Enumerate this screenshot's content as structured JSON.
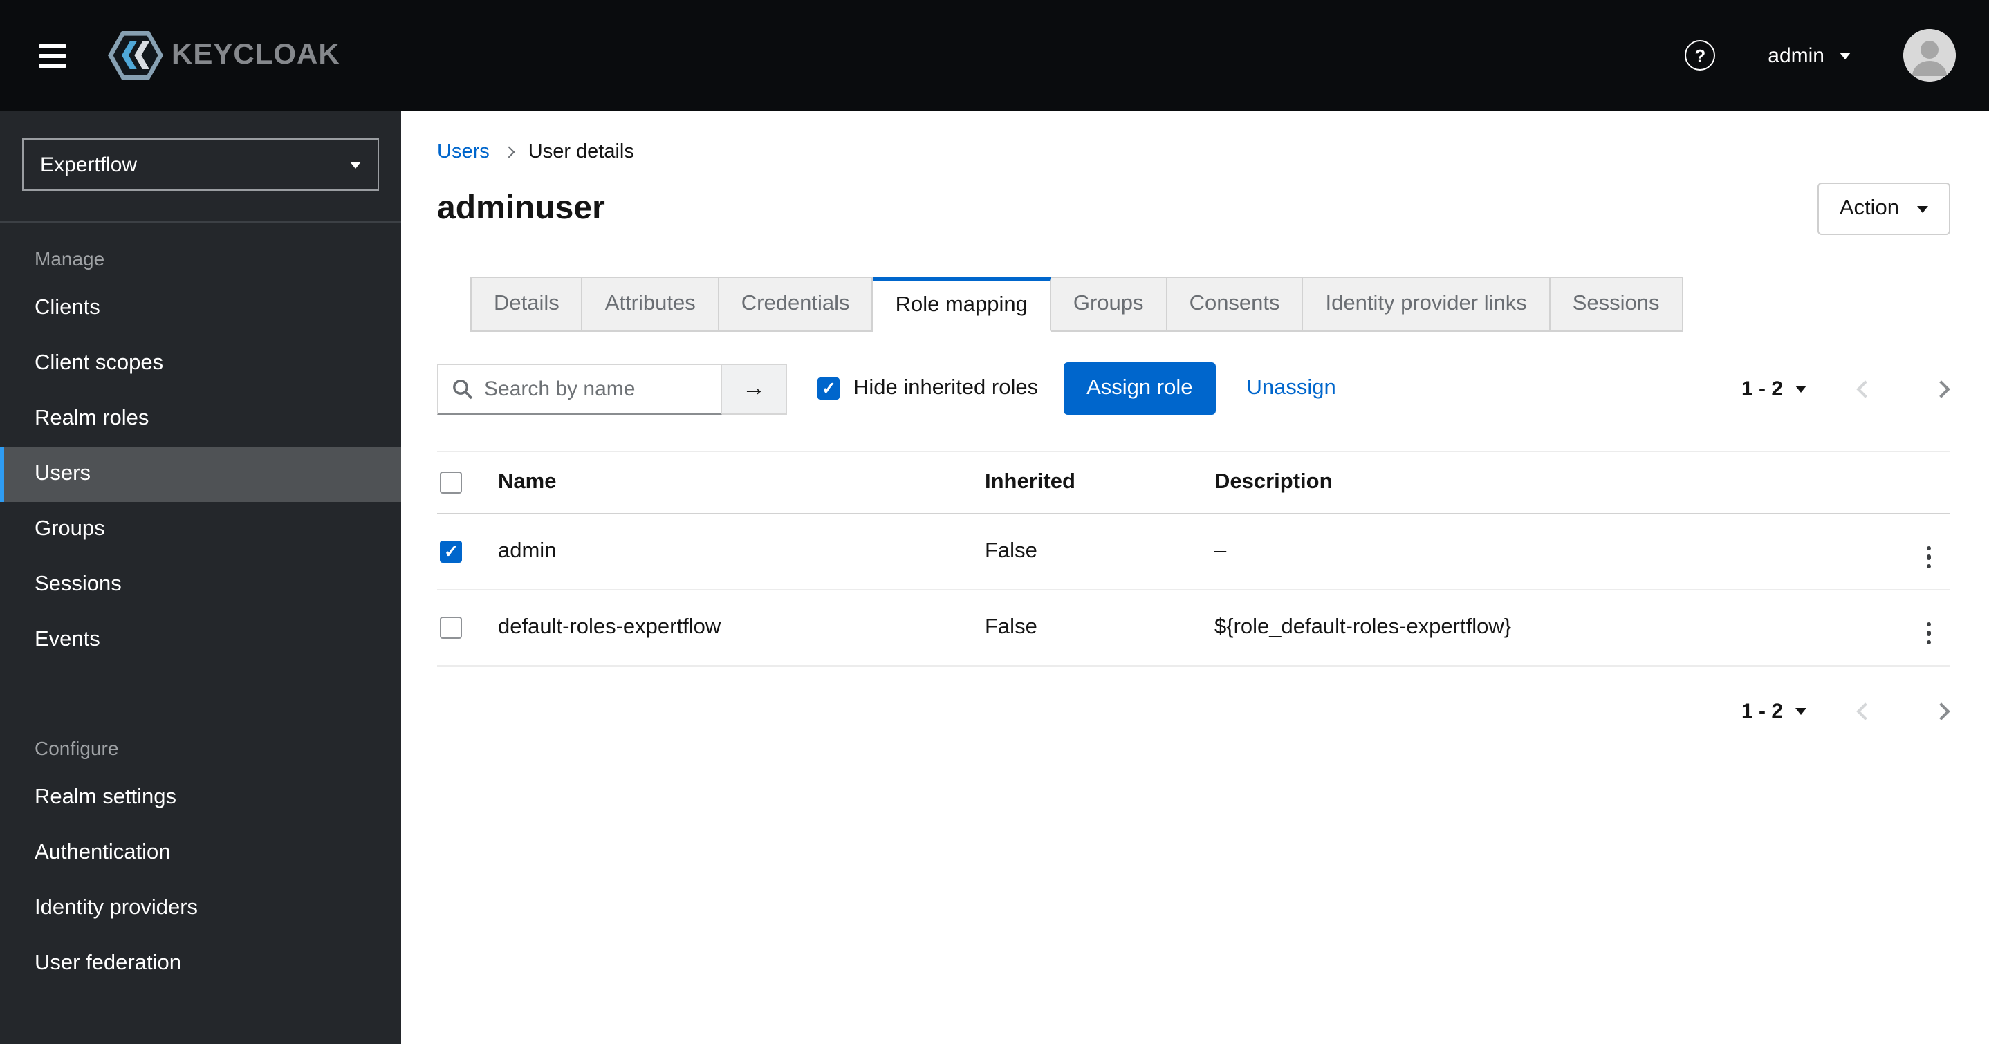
{
  "masthead": {
    "brand": "KEYCLOAK",
    "username": "admin"
  },
  "sidebar": {
    "realm": "Expertflow",
    "sections": [
      {
        "label": "Manage",
        "items": [
          {
            "label": "Clients",
            "current": false
          },
          {
            "label": "Client scopes",
            "current": false
          },
          {
            "label": "Realm roles",
            "current": false
          },
          {
            "label": "Users",
            "current": true
          },
          {
            "label": "Groups",
            "current": false
          },
          {
            "label": "Sessions",
            "current": false
          },
          {
            "label": "Events",
            "current": false
          }
        ]
      },
      {
        "label": "Configure",
        "items": [
          {
            "label": "Realm settings",
            "current": false
          },
          {
            "label": "Authentication",
            "current": false
          },
          {
            "label": "Identity providers",
            "current": false
          },
          {
            "label": "User federation",
            "current": false
          }
        ]
      }
    ]
  },
  "breadcrumb": {
    "items": [
      "Users",
      "User details"
    ]
  },
  "page": {
    "title": "adminuser",
    "action_label": "Action"
  },
  "tabs": [
    {
      "label": "Details",
      "active": false
    },
    {
      "label": "Attributes",
      "active": false
    },
    {
      "label": "Credentials",
      "active": false
    },
    {
      "label": "Role mapping",
      "active": true
    },
    {
      "label": "Groups",
      "active": false
    },
    {
      "label": "Consents",
      "active": false
    },
    {
      "label": "Identity provider links",
      "active": false
    },
    {
      "label": "Sessions",
      "active": false
    }
  ],
  "toolbar": {
    "search_placeholder": "Search by name",
    "hide_inherited_label": "Hide inherited roles",
    "hide_inherited_checked": true,
    "assign_label": "Assign role",
    "unassign_label": "Unassign",
    "pagination": "1 - 2"
  },
  "table": {
    "headers": [
      "Name",
      "Inherited",
      "Description"
    ],
    "rows": [
      {
        "checked": true,
        "name": "admin",
        "inherited": "False",
        "description": "–"
      },
      {
        "checked": false,
        "name": "default-roles-expertflow",
        "inherited": "False",
        "description": "${role_default-roles-expertflow}"
      }
    ]
  },
  "footer": {
    "pagination": "1 - 2"
  },
  "colors": {
    "accent": "#0066cc",
    "masthead_bg": "#0a0c0e",
    "sidebar_bg": "#24272b",
    "sidebar_current_bg": "#4f5255",
    "sidebar_current_accent": "#2e9cf3",
    "tab_inactive_bg": "#f0f0f0"
  }
}
